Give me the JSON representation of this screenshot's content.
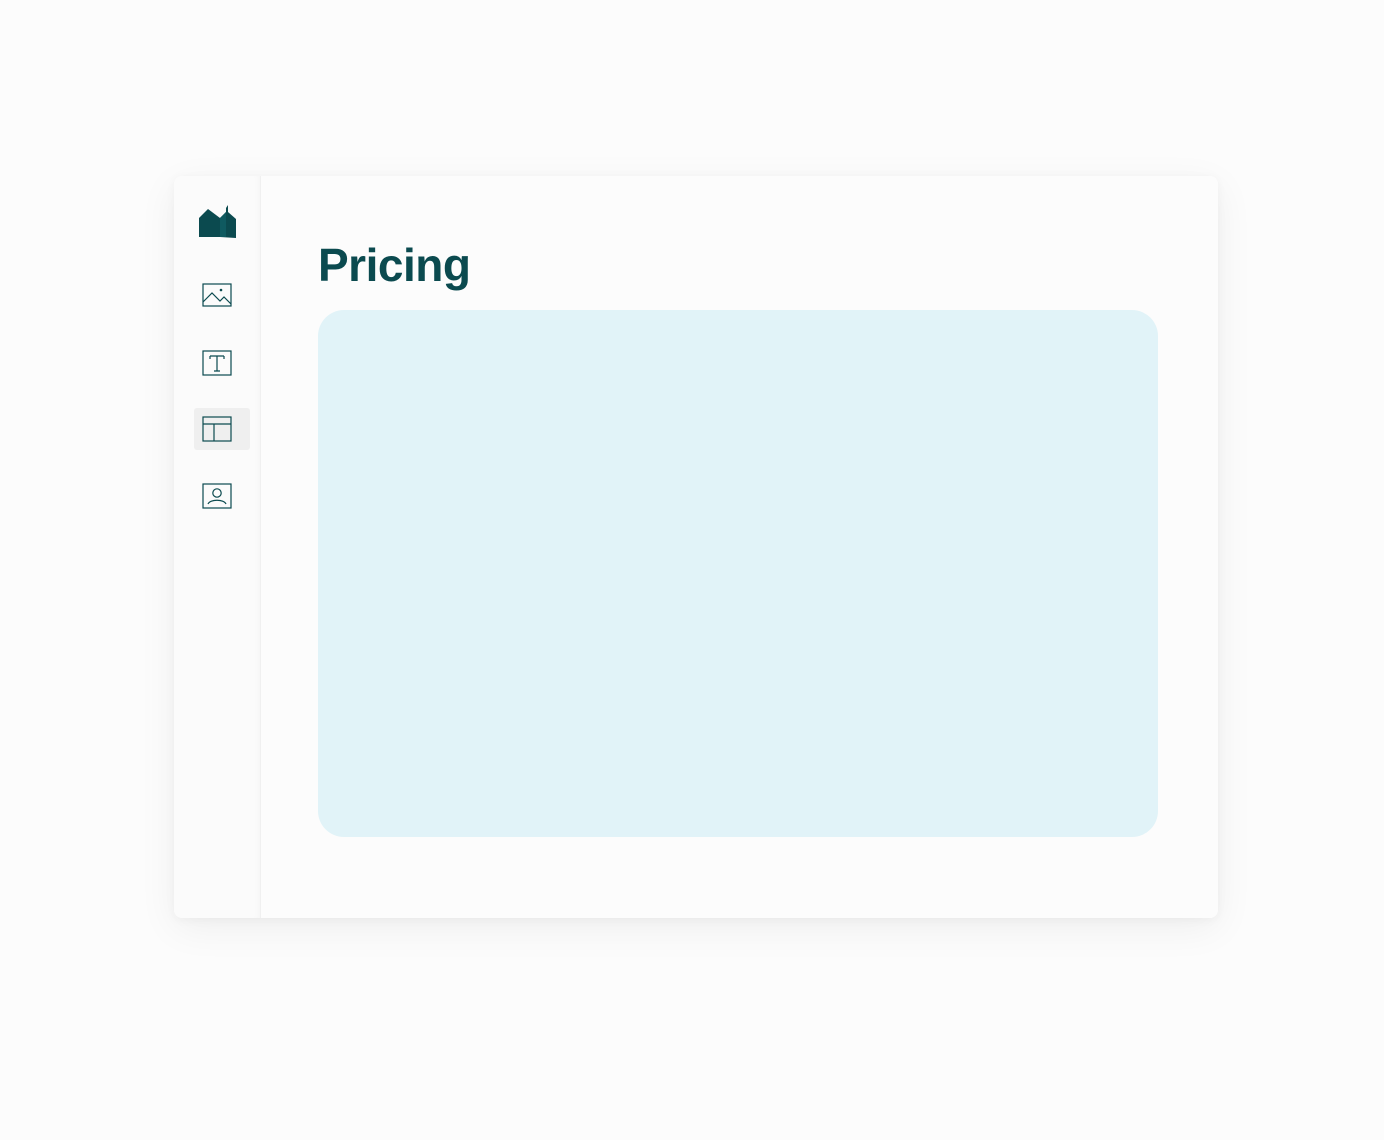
{
  "app": {
    "logo_icon": "bookmark-folds-logo",
    "accent_color": "#0b4a4f",
    "panel_color": "#e1f3f8"
  },
  "sidebar": {
    "items": [
      {
        "icon": "image-icon",
        "active": false
      },
      {
        "icon": "text-icon",
        "active": false
      },
      {
        "icon": "layout-icon",
        "active": true
      },
      {
        "icon": "contact-icon",
        "active": false
      }
    ]
  },
  "main": {
    "title": "Pricing"
  }
}
